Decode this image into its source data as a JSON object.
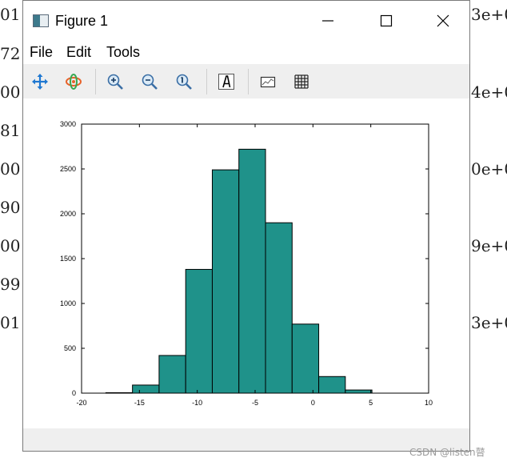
{
  "background": {
    "left_fragments": [
      "01",
      "72",
      "00",
      "81",
      "00",
      "90",
      "00",
      "99",
      "01"
    ],
    "right_fragments": [
      "3e+0",
      "4e+0",
      "0e+0",
      "9e+0",
      "3e+0"
    ]
  },
  "window": {
    "title": "Figure 1",
    "menu": [
      "File",
      "Edit",
      "Tools"
    ],
    "toolbar_icons": [
      "pan-icon",
      "rotate-icon",
      "zoom-in-icon",
      "zoom-out-icon",
      "zoom-reset-icon",
      "insert-text-icon",
      "insert-axes-icon",
      "grid-icon"
    ]
  },
  "colors": {
    "bar_fill": "#1f928a",
    "bar_edge": "#000000",
    "toolbar_bg": "#efefef"
  },
  "chart_data": {
    "type": "bar",
    "title": "",
    "xlabel": "",
    "ylabel": "",
    "xlim": [
      -20,
      10
    ],
    "ylim": [
      0,
      3000
    ],
    "xticks": [
      "-20",
      "-15",
      "-10",
      "-5",
      "0",
      "5",
      "10"
    ],
    "yticks": [
      "0",
      "500",
      "1000",
      "1500",
      "2000",
      "2500",
      "3000"
    ],
    "bins": [
      {
        "x0": -17.9,
        "x1": -15.6,
        "count": 5
      },
      {
        "x0": -15.6,
        "x1": -13.3,
        "count": 90
      },
      {
        "x0": -13.3,
        "x1": -11.0,
        "count": 420
      },
      {
        "x0": -11.0,
        "x1": -8.7,
        "count": 1380
      },
      {
        "x0": -8.7,
        "x1": -6.4,
        "count": 2490
      },
      {
        "x0": -6.4,
        "x1": -4.1,
        "count": 2720
      },
      {
        "x0": -4.1,
        "x1": -1.8,
        "count": 1900
      },
      {
        "x0": -1.8,
        "x1": 0.5,
        "count": 770
      },
      {
        "x0": 0.5,
        "x1": 2.8,
        "count": 185
      },
      {
        "x0": 2.8,
        "x1": 5.1,
        "count": 35
      }
    ]
  },
  "watermark": "CSDN @listen瞽"
}
